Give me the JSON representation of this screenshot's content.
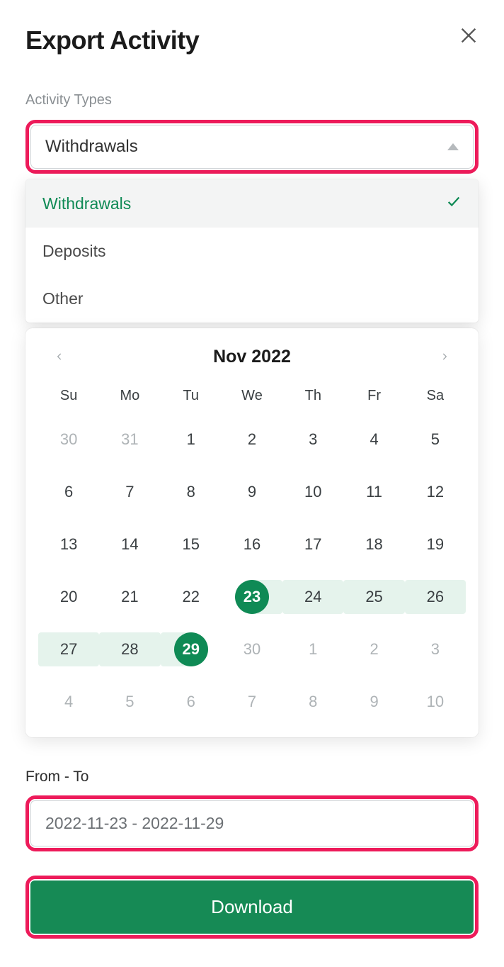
{
  "header": {
    "title": "Export Activity"
  },
  "activity": {
    "label": "Activity Types",
    "selected": "Withdrawals",
    "options": [
      "Withdrawals",
      "Deposits",
      "Other"
    ],
    "selectedIndex": 0
  },
  "calendar": {
    "monthLabel": "Nov 2022",
    "dow": [
      "Su",
      "Mo",
      "Tu",
      "We",
      "Th",
      "Fr",
      "Sa"
    ],
    "days": [
      {
        "n": "30",
        "out": true
      },
      {
        "n": "31",
        "out": true
      },
      {
        "n": "1"
      },
      {
        "n": "2"
      },
      {
        "n": "3"
      },
      {
        "n": "4"
      },
      {
        "n": "5"
      },
      {
        "n": "6"
      },
      {
        "n": "7"
      },
      {
        "n": "8"
      },
      {
        "n": "9"
      },
      {
        "n": "10"
      },
      {
        "n": "11"
      },
      {
        "n": "12"
      },
      {
        "n": "13"
      },
      {
        "n": "14"
      },
      {
        "n": "15"
      },
      {
        "n": "16"
      },
      {
        "n": "17"
      },
      {
        "n": "18"
      },
      {
        "n": "19"
      },
      {
        "n": "20"
      },
      {
        "n": "21"
      },
      {
        "n": "22"
      },
      {
        "n": "23",
        "sel": true,
        "rangeRight": true
      },
      {
        "n": "24",
        "rangeFull": true
      },
      {
        "n": "25",
        "rangeFull": true
      },
      {
        "n": "26",
        "rangeFull": true
      },
      {
        "n": "27",
        "rangeFull": true
      },
      {
        "n": "28",
        "rangeFull": true
      },
      {
        "n": "29",
        "sel": true,
        "rangeLeft": true
      },
      {
        "n": "30",
        "out": true
      },
      {
        "n": "1",
        "out": true
      },
      {
        "n": "2",
        "out": true
      },
      {
        "n": "3",
        "out": true
      },
      {
        "n": "4",
        "out": true
      },
      {
        "n": "5",
        "out": true
      },
      {
        "n": "6",
        "out": true
      },
      {
        "n": "7",
        "out": true
      },
      {
        "n": "8",
        "out": true
      },
      {
        "n": "9",
        "out": true
      },
      {
        "n": "10",
        "out": true
      }
    ]
  },
  "range": {
    "label": "From - To",
    "value": "2022-11-23 - 2022-11-29"
  },
  "actions": {
    "download": "Download"
  },
  "colors": {
    "accent": "#0f8a55",
    "highlight": "#ed1b5a"
  }
}
